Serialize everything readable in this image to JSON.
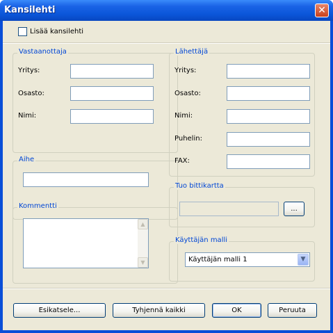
{
  "window": {
    "title": "Kansilehti"
  },
  "add_cover": {
    "label": "Lisää kansilehti",
    "checked": false
  },
  "recipient": {
    "legend": "Vastaanottaja",
    "company_label": "Yritys:",
    "department_label": "Osasto:",
    "name_label": "Nimi:"
  },
  "sender": {
    "legend": "Lähettäjä",
    "company_label": "Yritys:",
    "department_label": "Osasto:",
    "name_label": "Nimi:",
    "phone_label": "Puhelin:",
    "fax_label": "FAX:"
  },
  "subject": {
    "legend": "Aihe"
  },
  "comment": {
    "legend": "Kommentti"
  },
  "bitmap": {
    "legend": "Tuo bittikartta",
    "browse_label": "..."
  },
  "template": {
    "legend": "Käyttäjän malli",
    "selected": "Käyttäjän malli 1"
  },
  "buttons": {
    "preview": "Esikatsele...",
    "clear_all": "Tyhjennä kaikki",
    "ok": "OK",
    "cancel": "Peruuta"
  }
}
